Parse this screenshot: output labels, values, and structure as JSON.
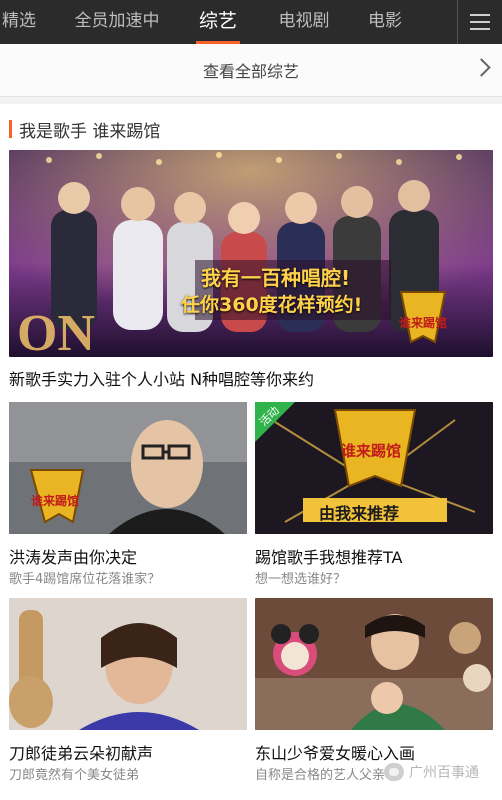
{
  "tabs": [
    {
      "label": "精选"
    },
    {
      "label": "全员加速中"
    },
    {
      "label": "综艺"
    },
    {
      "label": "电视剧"
    },
    {
      "label": "电影"
    }
  ],
  "active_tab": "综艺",
  "view_all": {
    "label": "查看全部综艺"
  },
  "section": {
    "title": "我是歌手 谁来踢馆"
  },
  "hero": {
    "caption": "新歌手实力入驻个人小站 N种唱腔等你来约",
    "banner_text_1": "我有一百种唱腔!",
    "banner_text_2": "任你360度花样预约!",
    "logo_text": "谁来踢馆"
  },
  "cards": [
    {
      "title": "洪涛发声由你决定",
      "subtitle": "歌手4踢馆席位花落谁家？",
      "logo_text": "谁来踢馆"
    },
    {
      "title": "踢馆歌手我想推荐TA",
      "subtitle": "想一想选谁好？",
      "badge": "活动",
      "logo_text": "谁来踢馆",
      "banner_text": "由我来推荐"
    },
    {
      "title": "刀郎徒弟云朵初献声",
      "subtitle": "刀郎竟然有个美女徒弟"
    },
    {
      "title": "东山少爷爱女暖心入画",
      "subtitle": "自称是合格的艺人父亲"
    }
  ],
  "watermark": {
    "text": "广州百事通"
  },
  "colors": {
    "accent": "#f7612b",
    "tabbar": "#2b2b2b"
  }
}
